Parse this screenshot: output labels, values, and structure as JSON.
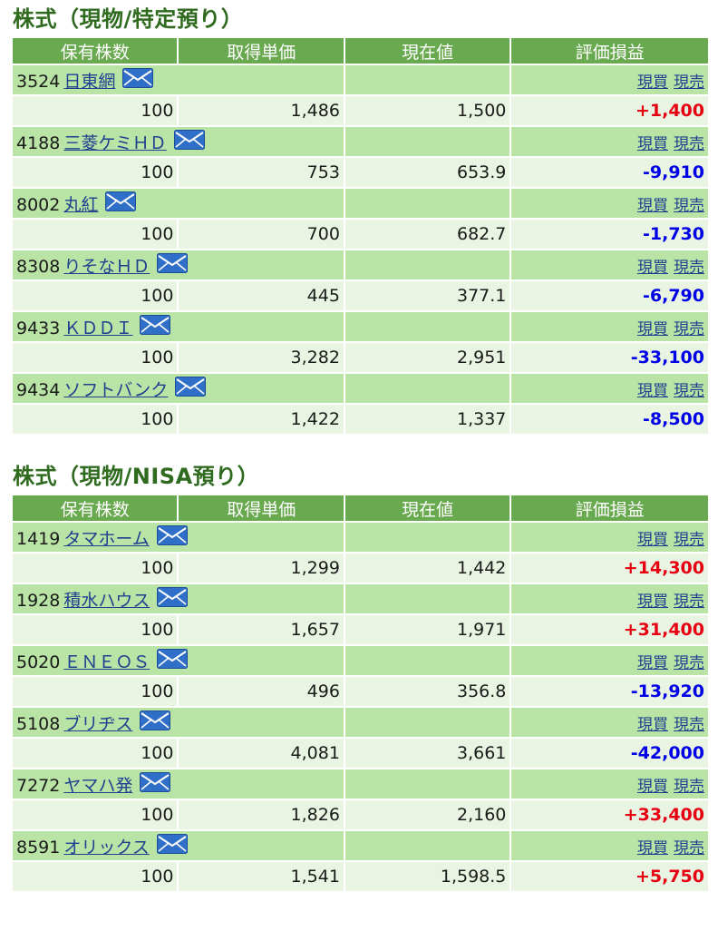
{
  "sections": [
    {
      "title": "株式（現物/特定預り）",
      "headers": [
        "保有株数",
        "取得単価",
        "現在値",
        "評価損益"
      ],
      "holdings": [
        {
          "code": "3524",
          "name": "日東網",
          "shares": "100",
          "cost": "1,486",
          "price": "1,500",
          "pl": "+1,400",
          "pl_sign": "pos"
        },
        {
          "code": "4188",
          "name": "三菱ケミＨＤ",
          "shares": "100",
          "cost": "753",
          "price": "653.9",
          "pl": "-9,910",
          "pl_sign": "neg"
        },
        {
          "code": "8002",
          "name": "丸紅",
          "shares": "100",
          "cost": "700",
          "price": "682.7",
          "pl": "-1,730",
          "pl_sign": "neg"
        },
        {
          "code": "8308",
          "name": "りそなＨＤ",
          "shares": "100",
          "cost": "445",
          "price": "377.1",
          "pl": "-6,790",
          "pl_sign": "neg"
        },
        {
          "code": "9433",
          "name": "ＫＤＤＩ",
          "shares": "100",
          "cost": "3,282",
          "price": "2,951",
          "pl": "-33,100",
          "pl_sign": "neg"
        },
        {
          "code": "9434",
          "name": "ソフトバンク",
          "shares": "100",
          "cost": "1,422",
          "price": "1,337",
          "pl": "-8,500",
          "pl_sign": "neg"
        }
      ]
    },
    {
      "title": "株式（現物/NISA預り）",
      "headers": [
        "保有株数",
        "取得単価",
        "現在値",
        "評価損益"
      ],
      "holdings": [
        {
          "code": "1419",
          "name": "タマホーム",
          "shares": "100",
          "cost": "1,299",
          "price": "1,442",
          "pl": "+14,300",
          "pl_sign": "pos"
        },
        {
          "code": "1928",
          "name": "積水ハウス",
          "shares": "100",
          "cost": "1,657",
          "price": "1,971",
          "pl": "+31,400",
          "pl_sign": "pos"
        },
        {
          "code": "5020",
          "name": "ＥＮＥＯＳ",
          "shares": "100",
          "cost": "496",
          "price": "356.8",
          "pl": "-13,920",
          "pl_sign": "neg"
        },
        {
          "code": "5108",
          "name": "ブリヂス",
          "shares": "100",
          "cost": "4,081",
          "price": "3,661",
          "pl": "-42,000",
          "pl_sign": "neg"
        },
        {
          "code": "7272",
          "name": "ヤマハ発",
          "shares": "100",
          "cost": "1,826",
          "price": "2,160",
          "pl": "+33,400",
          "pl_sign": "pos"
        },
        {
          "code": "8591",
          "name": "オリックス",
          "shares": "100",
          "cost": "1,541",
          "price": "1,598.5",
          "pl": "+5,750",
          "pl_sign": "pos"
        }
      ]
    }
  ],
  "row_links": {
    "buy": "現買",
    "sell": "現売"
  },
  "icons": {
    "mail": "mail-icon"
  },
  "colors": {
    "header_bg": "#69a94f",
    "name_row_bg": "#b9e4a6",
    "data_row_bg": "#e9f5e2",
    "title": "#2f6b1f",
    "positive": "#e60012",
    "negative": "#0000e6",
    "link": "#1f3f8f"
  }
}
